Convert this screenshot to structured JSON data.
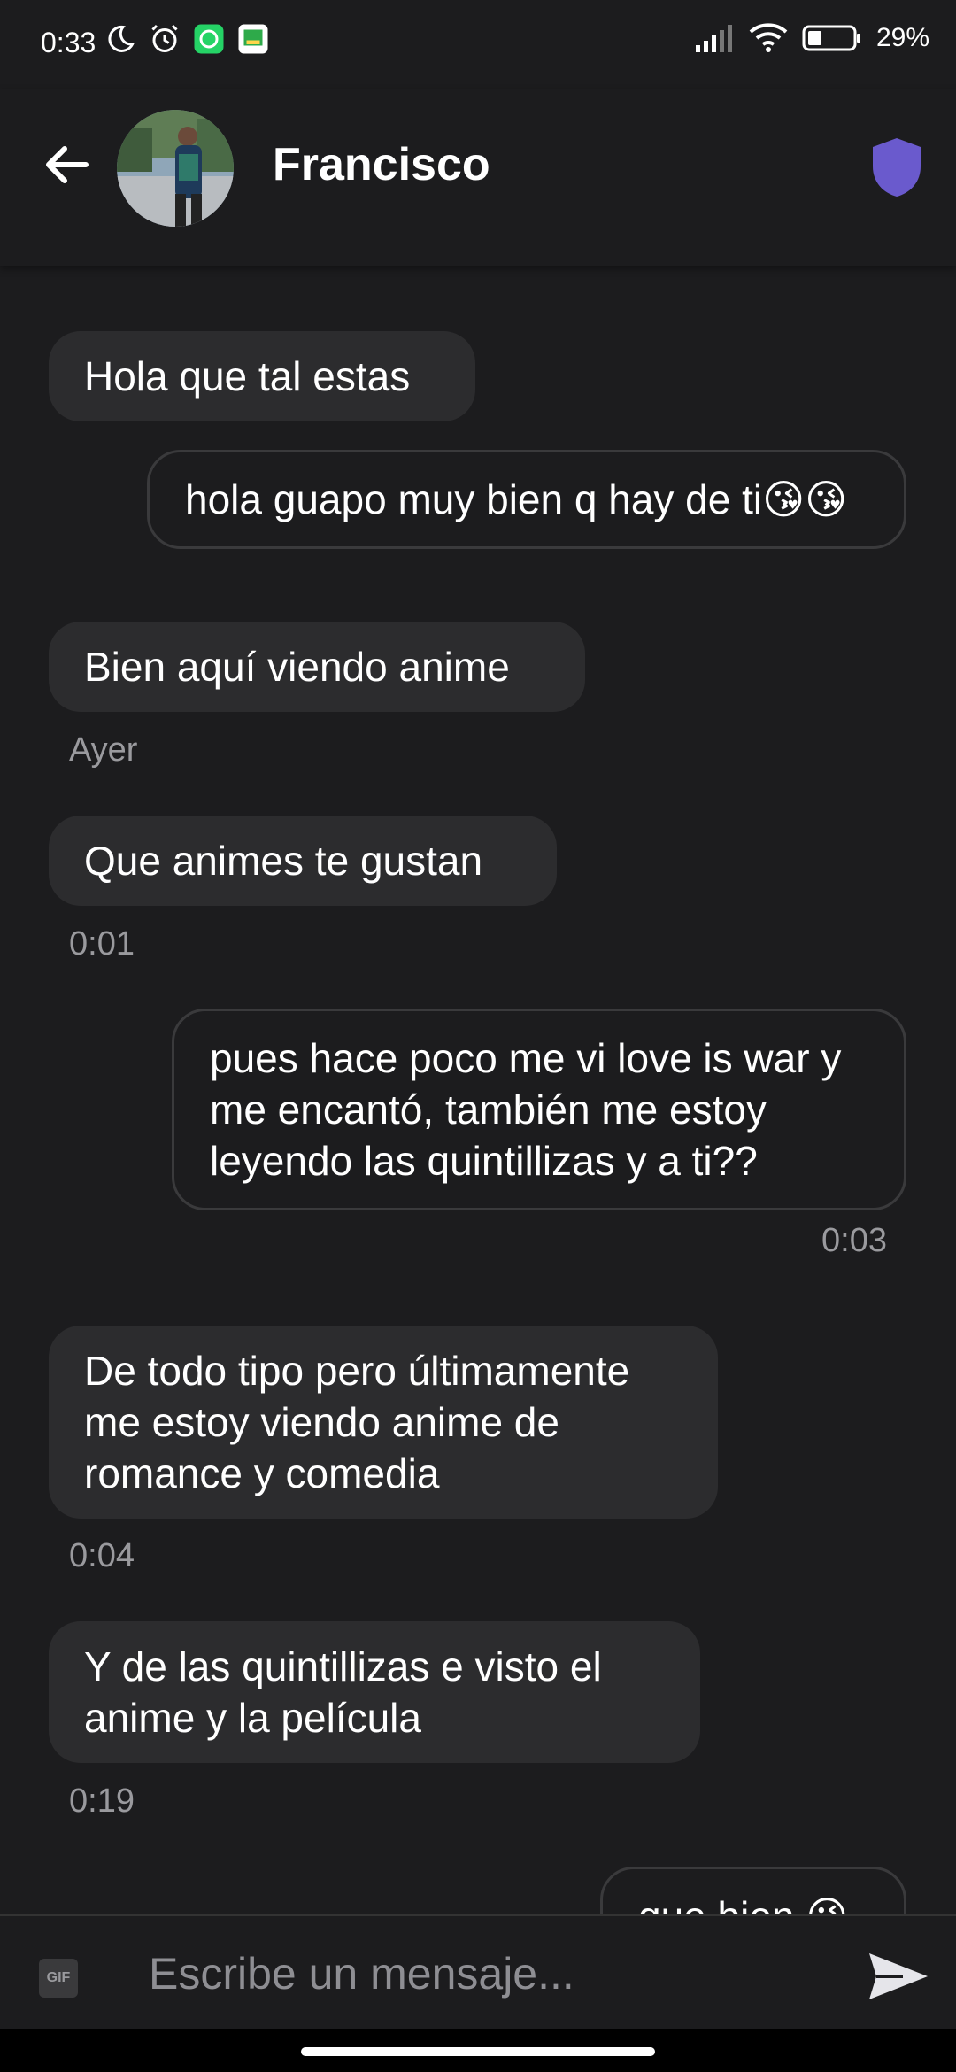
{
  "status_bar": {
    "time": "0:33",
    "battery": "29%",
    "icons": [
      "moon-icon",
      "alarm-icon",
      "whatsapp-icon",
      "gallery-icon",
      "signal-icon",
      "wifi-icon",
      "battery-icon"
    ]
  },
  "header": {
    "contact_name": "Francisco",
    "back_icon": "arrow-left-icon",
    "shield_icon": "shield-icon",
    "accent_color": "#6a5acd"
  },
  "messages": [
    {
      "direction": "in",
      "text": "Hola que tal estas"
    },
    {
      "direction": "out",
      "text": "hola guapo muy bien q hay de ti😘😘"
    },
    {
      "direction": "in",
      "text": "Bien aquí viendo anime",
      "time": "Ayer"
    },
    {
      "direction": "in",
      "text": "Que animes te gustan",
      "time": "0:01"
    },
    {
      "direction": "out",
      "text": "pues hace poco me vi love is war y me encantó, también me estoy leyendo las quintillizas y a ti??",
      "time": "0:03"
    },
    {
      "direction": "in",
      "text": "De todo tipo pero últimamente me estoy viendo anime de romance y comedia",
      "time": "0:04"
    },
    {
      "direction": "in",
      "text": "Y de las quintillizas e visto el anime y la película",
      "time": "0:19"
    },
    {
      "direction": "out",
      "text": "que bien 😘"
    }
  ],
  "composer": {
    "placeholder": "Escribe un mensaje...",
    "gif_label": "GIF"
  }
}
